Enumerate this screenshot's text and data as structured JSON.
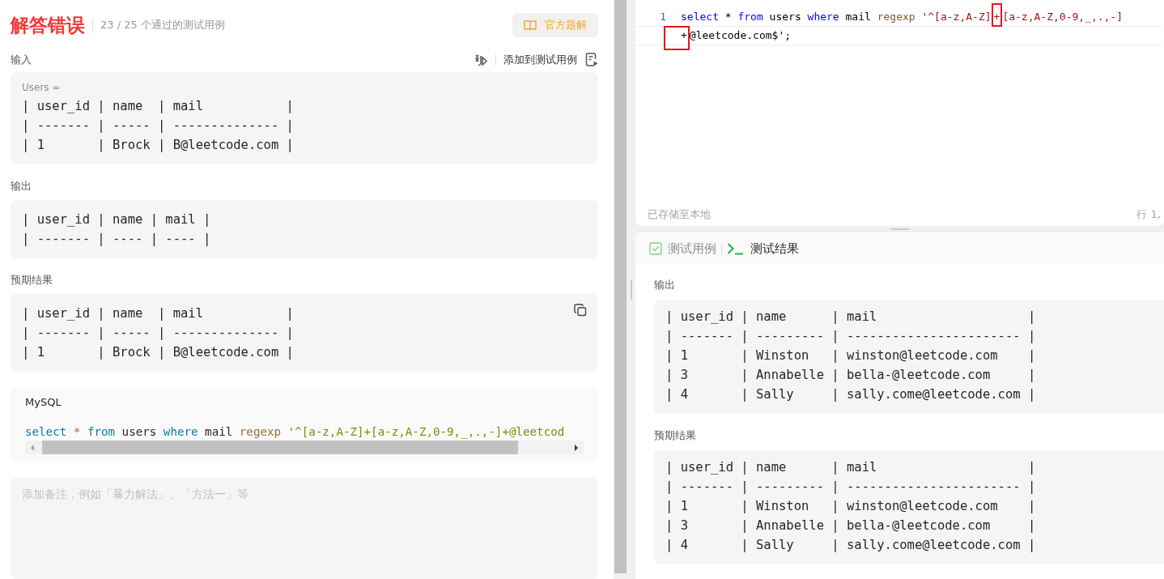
{
  "header": {
    "title": "解答错误",
    "summary": "23 / 25 个通过的测试用例",
    "solution_button": "官方题解"
  },
  "input": {
    "label": "输入",
    "add_button": "添加到测试用例",
    "var_label": "Users =",
    "lines": [
      "| user_id | name  | mail           |",
      "| ------- | ----- | -------------- |",
      "| 1       | Brock | B@leetcode.com |"
    ]
  },
  "output": {
    "label": "输出",
    "lines": [
      "| user_id | name | mail |",
      "| ------- | ---- | ---- |"
    ]
  },
  "expected": {
    "label": "预期结果",
    "lines": [
      "| user_id | name  | mail           |",
      "| ------- | ----- | -------------- |",
      "| 1       | Brock | B@leetcode.com |"
    ]
  },
  "submission": {
    "language": "MySQL",
    "tokens": [
      {
        "kind": "keyword",
        "text": "select"
      },
      {
        "kind": "operator",
        "text": " * "
      },
      {
        "kind": "keyword",
        "text": "from"
      },
      {
        "kind": "plain",
        "text": " users "
      },
      {
        "kind": "keyword",
        "text": "where"
      },
      {
        "kind": "plain",
        "text": " mail "
      },
      {
        "kind": "function",
        "text": "regexp"
      },
      {
        "kind": "string",
        "text": " '^[a-z,A-Z]+[a-z,A-Z,0-9,_,.,-]+@leetcod"
      }
    ]
  },
  "note": {
    "placeholder": "添加备注，例如「暴力解法」、「方法一」等"
  },
  "editor": {
    "lines": [
      {
        "number": "1",
        "rows": [
          [
            {
              "kind": "keyword",
              "text": "select"
            },
            {
              "kind": "plain",
              "text": " * "
            },
            {
              "kind": "keyword",
              "text": "from"
            },
            {
              "kind": "plain",
              "text": " users "
            },
            {
              "kind": "keyword",
              "text": "where"
            },
            {
              "kind": "plain",
              "text": " mail "
            },
            {
              "kind": "function",
              "text": "regexp"
            },
            {
              "kind": "string",
              "text": " '^[a-z,A-Z]"
            },
            {
              "kind": "string",
              "text": "+",
              "boxed": true
            },
            {
              "kind": "string",
              "text": "[a-z,A-Z,0-9,_,.,-]"
            }
          ],
          [
            {
              "kind": "plain",
              "text": "+",
              "boxed": true
            },
            {
              "kind": "plain",
              "text": "@leetcode.com$';"
            }
          ]
        ]
      }
    ],
    "status": "已存储至本地",
    "position": "行 1,"
  },
  "result_tabs": [
    {
      "label": "测试用例",
      "selected": false,
      "kind": "cases"
    },
    {
      "label": "测试结果",
      "selected": true,
      "kind": "results"
    }
  ],
  "result": {
    "output_label": "输出",
    "output_lines": [
      "| user_id | name      | mail                    |",
      "| ------- | --------- | ----------------------- |",
      "| 1       | Winston   | winston@leetcode.com    |",
      "| 3       | Annabelle | bella-@leetcode.com     |",
      "| 4       | Sally     | sally.come@leetcode.com |"
    ],
    "expected_label": "预期结果",
    "expected_lines": [
      "| user_id | name      | mail                    |",
      "| ------- | --------- | ----------------------- |",
      "| 1       | Winston   | winston@leetcode.com    |",
      "| 3       | Annabelle | bella-@leetcode.com     |",
      "| 4       | Sally     | sally.come@leetcode.com |"
    ]
  }
}
